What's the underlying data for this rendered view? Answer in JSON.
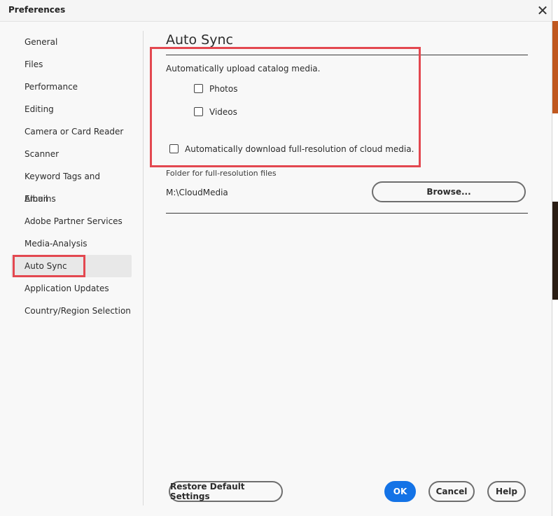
{
  "window": {
    "title": "Preferences",
    "close_icon": "close-icon"
  },
  "sidebar": {
    "items": [
      {
        "label": "General"
      },
      {
        "label": "Files"
      },
      {
        "label": "Performance"
      },
      {
        "label": "Editing"
      },
      {
        "label": "Camera or Card Reader"
      },
      {
        "label": "Scanner"
      },
      {
        "label": "Keyword Tags and Albums"
      },
      {
        "label": "Email"
      },
      {
        "label": "Adobe Partner Services"
      },
      {
        "label": "Media-Analysis"
      },
      {
        "label": "Auto Sync"
      },
      {
        "label": "Application Updates"
      },
      {
        "label": "Country/Region Selection"
      }
    ],
    "selected": "Auto Sync"
  },
  "auto_sync": {
    "heading": "Auto Sync",
    "upload_label": "Automatically upload catalog media.",
    "photos": {
      "label": "Photos",
      "checked": false
    },
    "videos": {
      "label": "Videos",
      "checked": false
    },
    "download": {
      "label": "Automatically download full-resolution of cloud media.",
      "checked": false
    },
    "folder_label": "Folder for full-resolution files",
    "folder_path": "M:\\CloudMedia",
    "browse_label": "Browse..."
  },
  "footer": {
    "restore_label": "Restore Default Settings",
    "ok_label": "OK",
    "cancel_label": "Cancel",
    "help_label": "Help"
  },
  "colors": {
    "accent": "#1473e6",
    "highlight": "#e34850"
  }
}
